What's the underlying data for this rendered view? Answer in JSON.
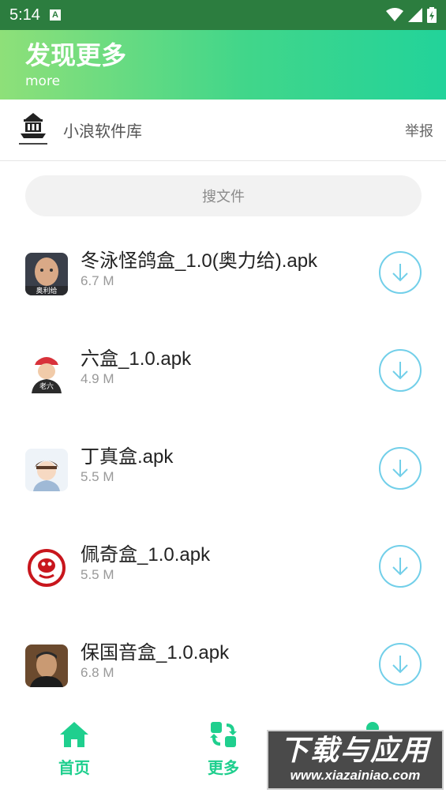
{
  "statusbar": {
    "time": "5:14",
    "notification_glyph": "A"
  },
  "header": {
    "title": "发现更多",
    "subtitle": "more"
  },
  "source": {
    "name": "小浪软件库",
    "report_label": "举报"
  },
  "search": {
    "placeholder": "搜文件"
  },
  "files": [
    {
      "name": "冬泳怪鸽盒_1.0(奥力给).apk",
      "size": "6.7 M",
      "thumb_caption": "奥利给"
    },
    {
      "name": "六盒_1.0.apk",
      "size": "4.9 M",
      "thumb_caption": "老六"
    },
    {
      "name": "丁真盒.apk",
      "size": "5.5 M",
      "thumb_caption": ""
    },
    {
      "name": "佩奇盒_1.0.apk",
      "size": "5.5 M",
      "thumb_caption": ""
    },
    {
      "name": "保国音盒_1.0.apk",
      "size": "6.8 M",
      "thumb_caption": ""
    }
  ],
  "nav": [
    {
      "label": "首页",
      "icon": "home-icon"
    },
    {
      "label": "更多",
      "icon": "apps-refresh-icon"
    },
    {
      "label": "",
      "icon": "user-icon"
    }
  ],
  "watermark": {
    "line1": "下载与应用",
    "line2": "www.xiazainiao.com"
  },
  "colors": {
    "accent": "#1fcf8e",
    "download_ring": "#72cfe9",
    "statusbar": "#2c7d3f"
  }
}
